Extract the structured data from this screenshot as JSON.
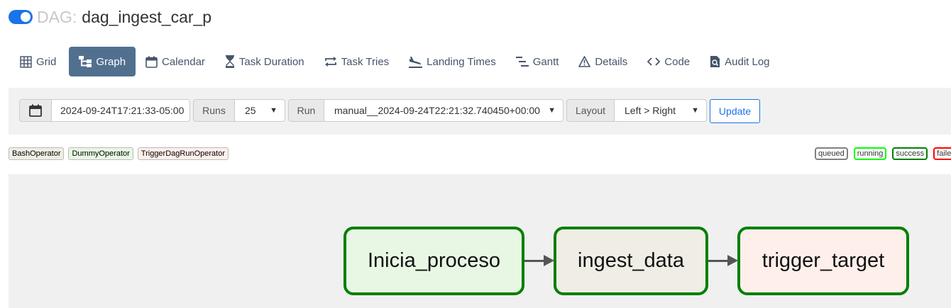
{
  "header": {
    "prefix": "DAG:",
    "dag_id": "dag_ingest_car_p",
    "toggle_on": true
  },
  "tabs": [
    {
      "label": "Grid",
      "icon": "grid-icon",
      "active": false
    },
    {
      "label": "Graph",
      "icon": "graph-icon",
      "active": true
    },
    {
      "label": "Calendar",
      "icon": "calendar-icon",
      "active": false
    },
    {
      "label": "Task Duration",
      "icon": "hourglass-icon",
      "active": false
    },
    {
      "label": "Task Tries",
      "icon": "repeat-icon",
      "active": false
    },
    {
      "label": "Landing Times",
      "icon": "plane-landing-icon",
      "active": false
    },
    {
      "label": "Gantt",
      "icon": "gantt-icon",
      "active": false
    },
    {
      "label": "Details",
      "icon": "warning-triangle-icon",
      "active": false
    },
    {
      "label": "Code",
      "icon": "code-icon",
      "active": false
    },
    {
      "label": "Audit Log",
      "icon": "file-search-icon",
      "active": false
    }
  ],
  "toolbar": {
    "base_date": "2024-09-24T17:21:33-05:00",
    "runs_label": "Runs",
    "runs_value": "25",
    "run_label": "Run",
    "run_value": "manual__2024-09-24T22:21:32.740450+00:00",
    "layout_label": "Layout",
    "layout_value": "Left > Right",
    "update_label": "Update"
  },
  "operators": [
    {
      "label": "BashOperator",
      "color": "#f0ede4"
    },
    {
      "label": "DummyOperator",
      "color": "#e8f7e4"
    },
    {
      "label": "TriggerDagRunOperator",
      "color": "#ffefeb"
    }
  ],
  "states": [
    {
      "label": "queued",
      "color": "#808080"
    },
    {
      "label": "running",
      "color": "#00ff00"
    },
    {
      "label": "success",
      "color": "#008000"
    },
    {
      "label": "failed",
      "color": "#ff0000"
    }
  ],
  "graph": {
    "nodes": [
      {
        "label": "Inicia_proceso",
        "fill": "#e8f7e4",
        "state": "success"
      },
      {
        "label": "ingest_data",
        "fill": "#f0ede4",
        "state": "success"
      },
      {
        "label": "trigger_target",
        "fill": "#ffefeb",
        "state": "success"
      }
    ],
    "edge_color": "#555555"
  }
}
